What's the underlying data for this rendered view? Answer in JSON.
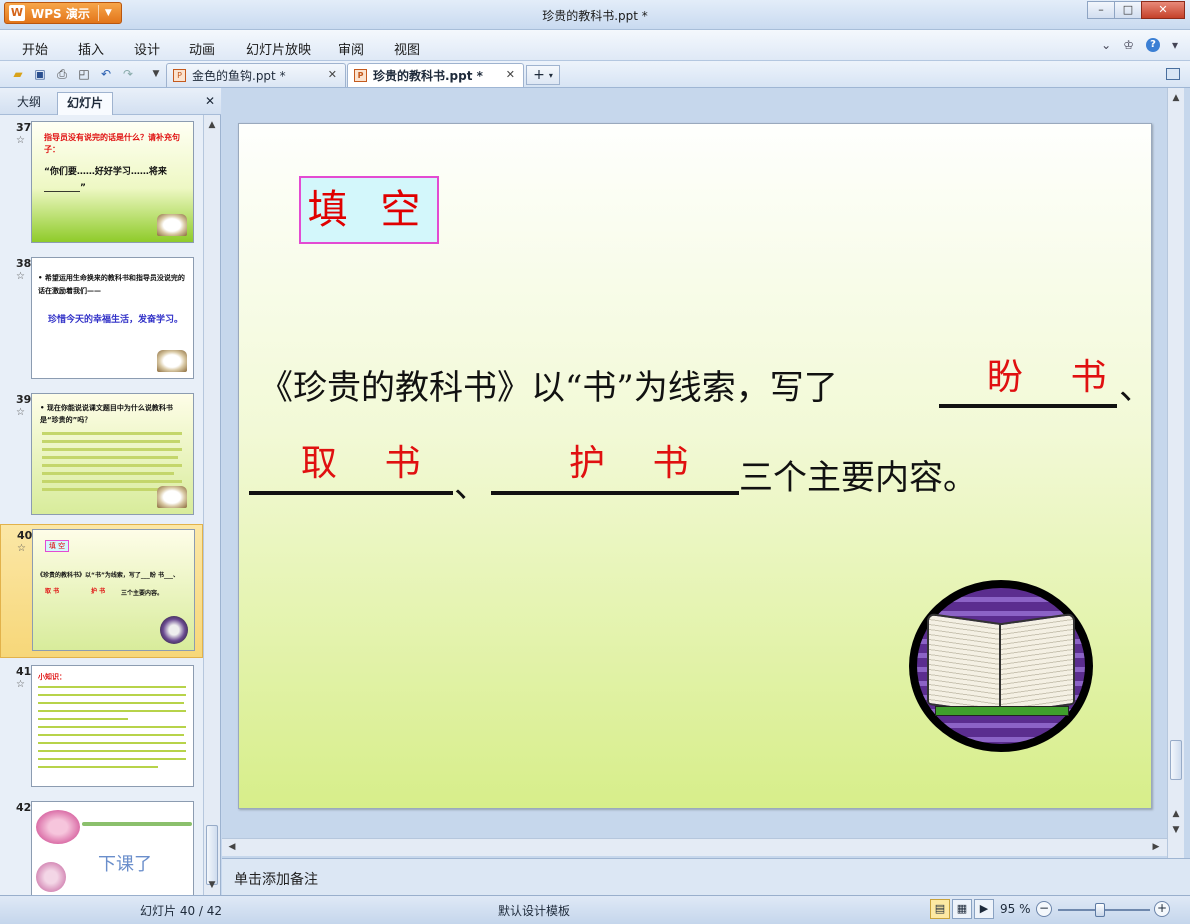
{
  "app": {
    "name": "WPS 演示",
    "window_title": "珍贵的教科书.ppt *",
    "logo_letter": "W"
  },
  "window_controls": {
    "minimize": "–",
    "restore": "□",
    "close": "✕"
  },
  "menu": [
    "开始",
    "插入",
    "设计",
    "动画",
    "幻灯片放映",
    "审阅",
    "视图"
  ],
  "tabs": [
    {
      "label": "金色的鱼钩.ppt *",
      "active": false
    },
    {
      "label": "珍贵的教科书.ppt *",
      "active": true
    }
  ],
  "left_panel": {
    "tabs": [
      "大纲",
      "幻灯片"
    ],
    "active_tab": "幻灯片",
    "thumbnails": [
      {
        "num": "37",
        "lines": [
          "指导员没有说完的话是什么？请补充句子：",
          "“你们要……好好学习……将来________”"
        ]
      },
      {
        "num": "38",
        "lines": [
          "• 希望运用生命换来的教科书和指导员没说完的话在激励着我们——",
          "珍惜今天的幸福生活，发奋学习。"
        ]
      },
      {
        "num": "39",
        "lines": [
          "• 现在你能说说课文题目中为什么说教科书是“珍贵的”吗？"
        ]
      },
      {
        "num": "40",
        "selected": true,
        "lines": [
          "填 空",
          "《珍贵的教科书》以“书”为线索，写了___盼 书___、",
          "取 书",
          "护 书",
          "三个主要内容。"
        ]
      },
      {
        "num": "41",
        "lines": [
          "小知识："
        ]
      },
      {
        "num": "42",
        "lines": [
          "下课了"
        ]
      }
    ]
  },
  "slide": {
    "title": "填 空",
    "line1_text": "《珍贵的教科书》以“书”为线索，写了",
    "sep_comma": "、",
    "line2_tail": "三个主要内容。",
    "answers": [
      "盼 书",
      "取 书",
      "护 书"
    ]
  },
  "notes_placeholder": "单击添加备注",
  "status": {
    "slide_info": "幻灯片 40 / 42",
    "template": "默认设计模板",
    "zoom": "95 %"
  }
}
